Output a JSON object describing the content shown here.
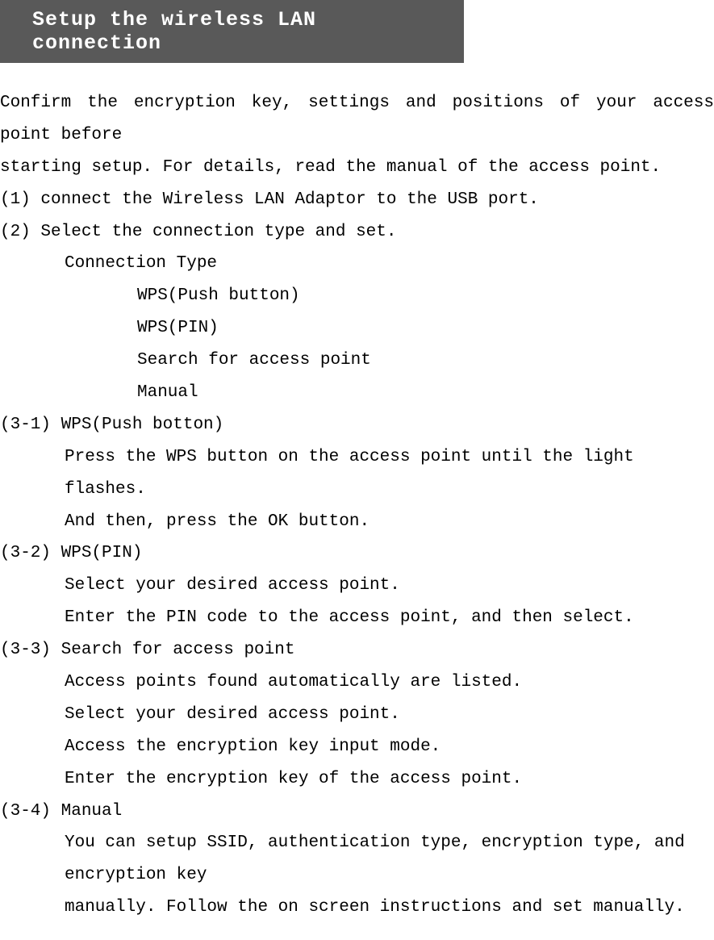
{
  "title": "Setup the wireless LAN connection",
  "intro_line1": "Confirm the encryption key, settings and positions of your access point before",
  "intro_line2": "starting setup. For details, read the manual of the access point.",
  "step1": "(1) connect the Wireless LAN Adaptor to the USB port.",
  "step2": "(2) Select the connection type and set.",
  "connection_type_label": "Connection Type",
  "connection_types": {
    "wps_push": "WPS(Push button)",
    "wps_pin": "WPS(PIN)",
    "search": "Search for access point",
    "manual": "Manual"
  },
  "step3_1_label": "(3-1) WPS(Push botton)",
  "step3_1_line1": "Press the WPS button on the access point until the light flashes.",
  "step3_1_line2": "And then, press the OK button.",
  "step3_2_label": "(3-2) WPS(PIN)",
  "step3_2_line1": "Select your desired access point.",
  "step3_2_line2": "Enter the PIN code to the access point, and then select.",
  "step3_3_label": "(3-3) Search for access point",
  "step3_3_line1": "Access points found automatically are listed.",
  "step3_3_line2": "Select your desired access point.",
  "step3_3_line3": "Access the encryption key input mode.",
  "step3_3_line4": "Enter the encryption key of the access point.",
  "step3_4_label": "(3-4) Manual",
  "step3_4_line1": "You can setup SSID, authentication type, encryption type, and encryption key",
  "step3_4_line2": "manually. Follow the on screen instructions and set manually."
}
